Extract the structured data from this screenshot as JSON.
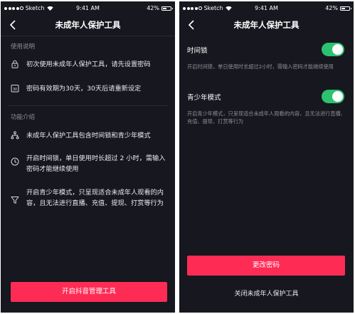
{
  "status_bar": {
    "carrier": "Sketch",
    "time": "9:41 AM",
    "battery": "42%"
  },
  "left_screen": {
    "title": "未成年人保护工具",
    "section_usage": "使用说明",
    "usage_items": [
      {
        "icon": "lock-icon",
        "text": "初次使用未成年人保护工具，请先设置密码"
      },
      {
        "icon": "calendar-30-icon",
        "text": "密码有效期为30天，30天后请重新设定"
      }
    ],
    "calendar_icon_text": "30",
    "section_features": "功能介绍",
    "feature_items": [
      {
        "icon": "hierarchy-icon",
        "text": "未成年人保护工具包含时间锁和青少年模式"
      },
      {
        "icon": "clock-icon",
        "text": "开启时间锁，单日使用时长超过 2 小时，需输入密码才能继续使用"
      },
      {
        "icon": "filter-icon",
        "text": "开启青少年模式，只呈现适合未成年人观看的内容，且无法进行直播、充值、提现、打赏等行为"
      }
    ],
    "button_label": "开启抖音管理工具"
  },
  "right_screen": {
    "title": "未成年人保护工具",
    "time_lock_title": "时间锁",
    "time_lock_desc": "开启时间锁，单日使用时长超过2小时，需输入密码才能继续使用",
    "time_lock_on": true,
    "youth_mode_title": "青少年模式",
    "youth_mode_desc": "开启青少年模式，只呈现适合未成年人观看的内容，且无法进行直播、充值、提现、打赏等行为",
    "youth_mode_on": true,
    "change_password_label": "更改密码",
    "close_tool_label": "关闭未成年人保护工具"
  },
  "colors": {
    "background": "#17171f",
    "accent": "#fe2c55",
    "toggle_on": "#2cc270",
    "muted_text": "#8e8e96"
  }
}
